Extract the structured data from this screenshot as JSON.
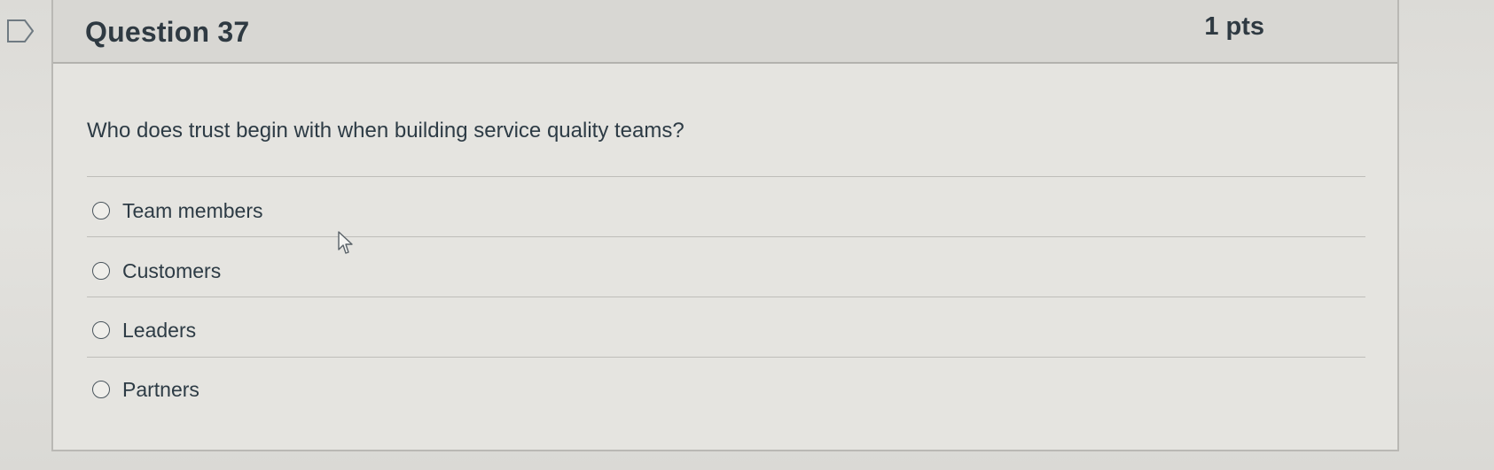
{
  "question": {
    "title": "Question 37",
    "points": "1 pts",
    "text": "Who does trust begin with when building service quality teams?",
    "answers": [
      {
        "label": "Team members",
        "selected": false
      },
      {
        "label": "Customers",
        "selected": false
      },
      {
        "label": "Leaders",
        "selected": false
      },
      {
        "label": "Partners",
        "selected": false
      }
    ]
  },
  "icons": {
    "bookmark": "bookmark-flag-icon",
    "cursor": "mouse-pointer-icon"
  }
}
